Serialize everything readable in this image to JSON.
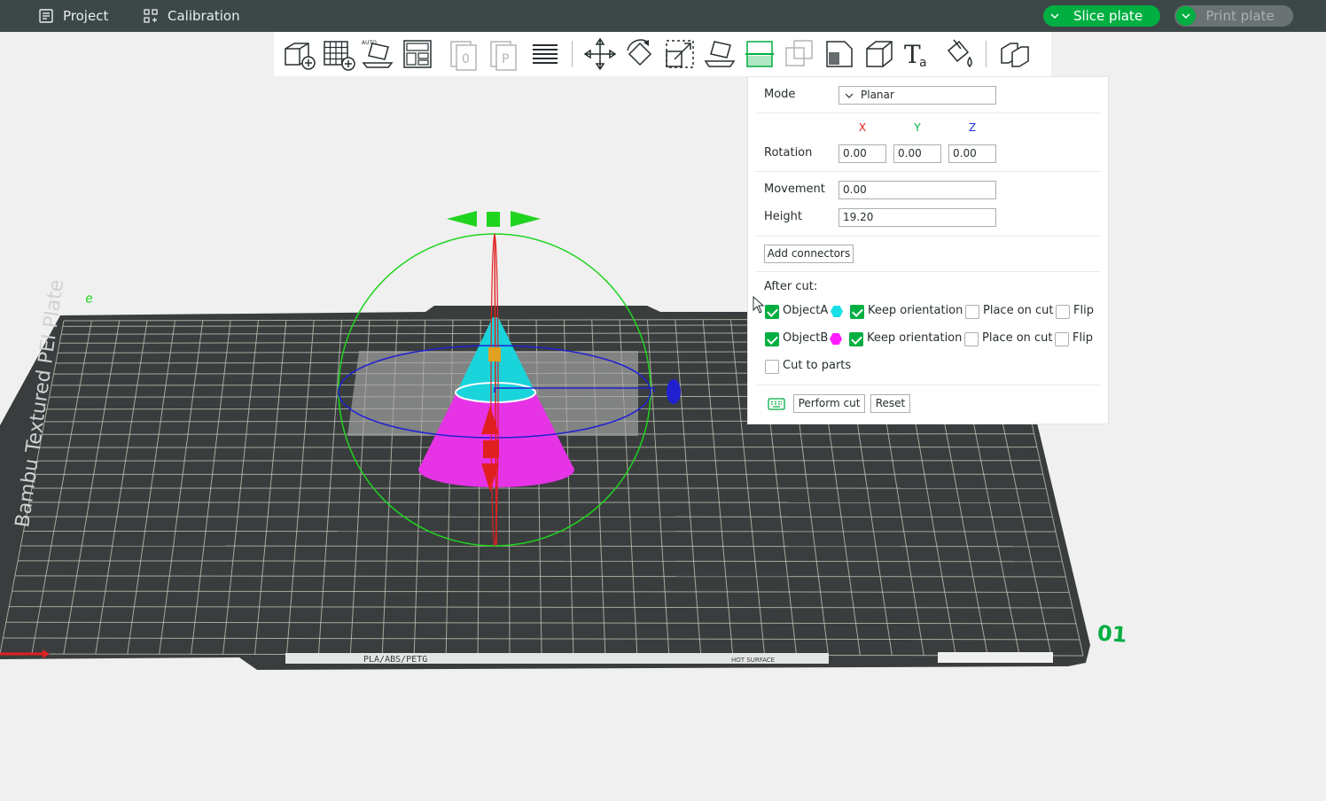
{
  "menu": {
    "project_label": "Project",
    "calibration_label": "Calibration",
    "slice_label": "Slice plate",
    "print_label": "Print plate"
  },
  "toolbar": {
    "icons": [
      "add-object-icon",
      "grid-arrange-icon",
      "auto-orient-icon",
      "layout-icon",
      "plate-zero-icon",
      "plate-p-icon",
      "layers-icon",
      "move-icon",
      "rotate-icon",
      "scale-icon",
      "lay-on-face-icon",
      "cut-icon",
      "boolean-icon",
      "support-paint-icon",
      "seam-icon",
      "text-icon",
      "color-paint-icon",
      "assembly-icon"
    ],
    "active": "cut-icon"
  },
  "bed": {
    "brand_text": "Bambu Textured PEI Plate",
    "bottom_label": "PLA/ABS/PETG",
    "hot_label": "HOT SURFACE",
    "plate_number": "01",
    "bed_color": "#3a3d3e",
    "grid_color": "#c9cdb8"
  },
  "cut_panel": {
    "mode_label": "Mode",
    "mode_value": "Planar",
    "axis_x": "X",
    "axis_y": "Y",
    "axis_z": "Z",
    "axis_x_color": "#e02020",
    "axis_y_color": "#00ae42",
    "axis_z_color": "#2032d8",
    "rotation_label": "Rotation",
    "rotation_x": "0.00",
    "rotation_y": "0.00",
    "rotation_z": "0.00",
    "movement_label": "Movement",
    "movement_value": "0.00",
    "height_label": "Height",
    "height_value": "19.20",
    "add_connectors_label": "Add connectors",
    "after_cut_label": "After cut:",
    "object_a": {
      "label": "ObjectA",
      "checked": true,
      "color": "#16e0e8",
      "keep_orientation_label": "Keep orientation",
      "keep_orientation": true,
      "place_on_cut_label": "Place on cut",
      "place_on_cut": false,
      "flip_label": "Flip",
      "flip": false
    },
    "object_b": {
      "label": "ObjectB",
      "checked": true,
      "color": "#ff1aff",
      "keep_orientation_label": "Keep orientation",
      "keep_orientation": true,
      "place_on_cut_label": "Place on cut",
      "place_on_cut": false,
      "flip_label": "Flip",
      "flip": false
    },
    "cut_to_parts_label": "Cut to parts",
    "cut_to_parts": false,
    "perform_cut_label": "Perform cut",
    "reset_label": "Reset"
  }
}
